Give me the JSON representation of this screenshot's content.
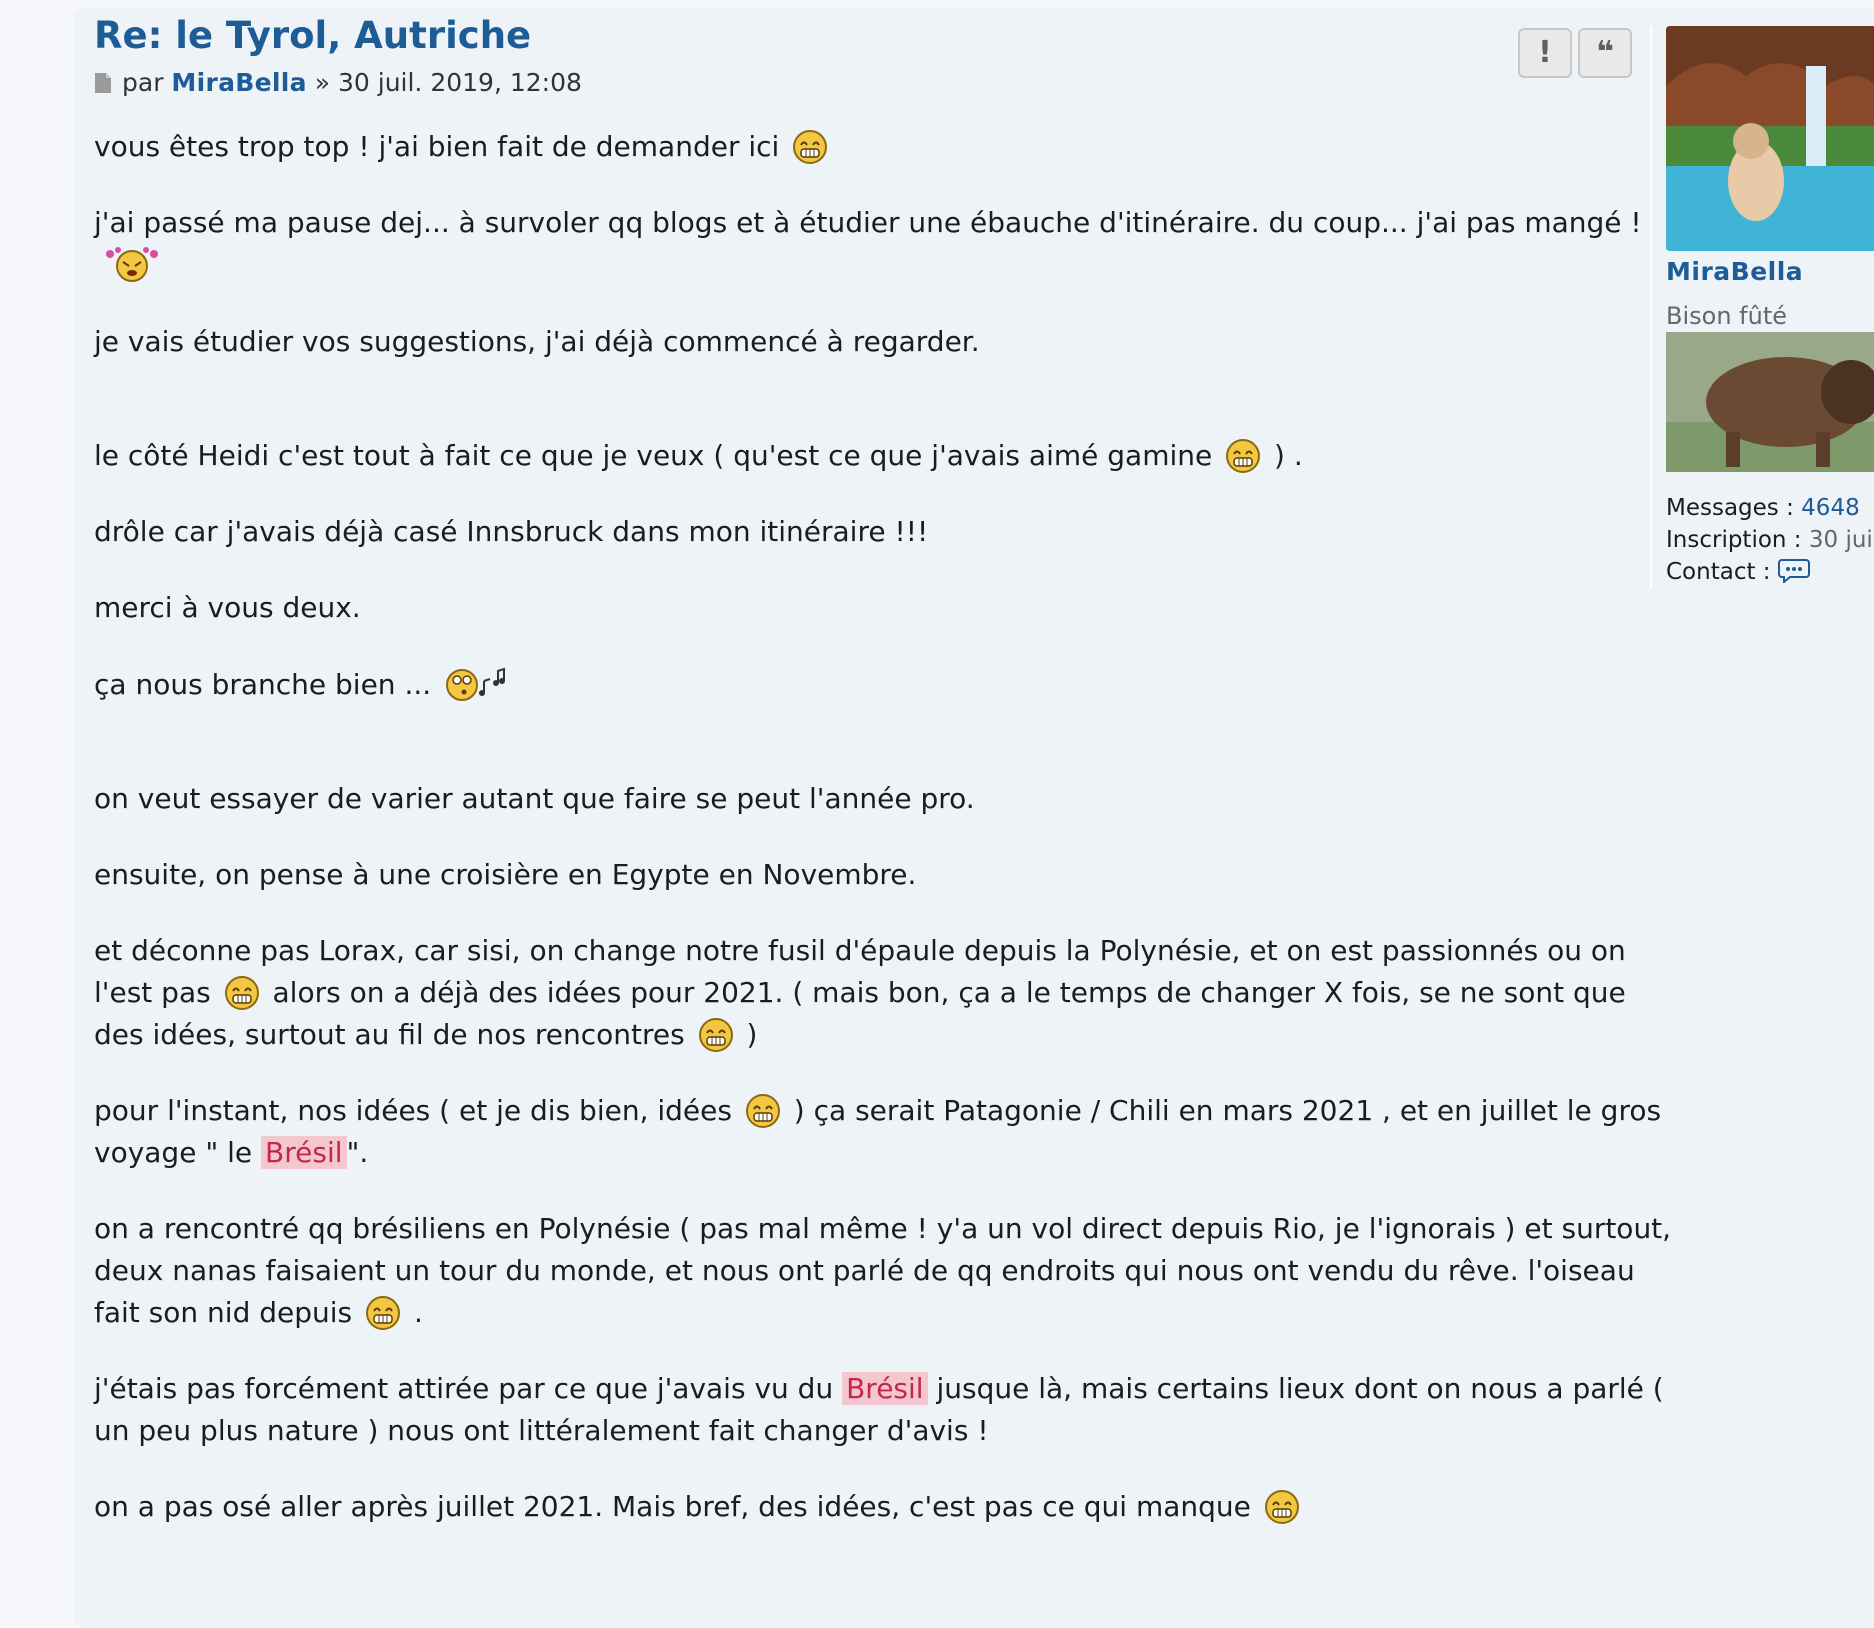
{
  "post": {
    "title": "Re: le Tyrol, Autriche",
    "by_label": "par",
    "author": "MiraBella",
    "date": "» 30 juil. 2019, 12:08",
    "buttons": {
      "report": "!",
      "quote": "❝"
    },
    "paragraphs": [
      {
        "text": "vous êtes trop top ! j'ai bien fait de demander ici",
        "smiley": "grin"
      },
      {
        "text": "j'ai passé ma pause dej... à survoler qq blogs et à étudier une ébauche d'itinéraire. du coup... j'ai pas mangé !",
        "smiley": "dizzy"
      },
      {
        "text": "je vais étudier vos suggestions, j'ai déjà commencé à regarder."
      },
      {
        "text_a": "le côté Heidi c'est tout à fait ce que je veux ( qu'est ce que j'avais aimé gamine",
        "text_b": ") ."
      },
      {
        "text": "drôle car j'avais déjà casé Innsbruck dans mon itinéraire !!!"
      },
      {
        "text": "merci à vous deux."
      },
      {
        "text": "ça nous branche bien ...",
        "smiley": "whistle"
      },
      {
        "text": "on veut essayer de varier autant que faire se peut l'année pro."
      },
      {
        "text": "ensuite, on pense à une croisière en Egypte en Novembre."
      },
      {
        "text_a": "et déconne pas Lorax, car sisi, on change notre fusil d'épaule depuis la Polynésie, et on est passionnés ou on l'est pas",
        "text_b": "alors on a déjà des idées pour 2021. ( mais bon, ça a le temps de changer X fois, se ne sont que des idées, surtout au fil de nos rencontres",
        "text_c": ")"
      },
      {
        "text_a": "pour l'instant, nos idées ( et je dis bien, idées",
        "text_b": ") ça serait Patagonie / Chili en mars 2021 , et en juillet le gros voyage \" le",
        "highlight": "Brésil",
        "text_c": "\"."
      },
      {
        "text_a": "on a rencontré qq brésiliens en Polynésie ( pas mal même ! y'a un vol direct depuis Rio, je l'ignorais ) et surtout, deux nanas faisaient un tour du monde, et nous ont parlé de qq endroits qui nous ont vendu du rêve. l'oiseau fait son nid depuis",
        "text_b": "."
      },
      {
        "text_a": "j'étais pas forcément attirée par ce que j'avais vu du",
        "highlight": "Brésil",
        "text_b": "jusque là, mais certains lieux dont on nous a parlé ( un peu plus nature ) nous ont littéralement fait changer d'avis !"
      },
      {
        "text": "on a pas osé aller après juillet 2021. Mais bref, des idées, c'est pas ce qui manque",
        "smiley": "grin"
      }
    ]
  },
  "profile": {
    "username": "MiraBella",
    "rank": "Bison fûté",
    "messages_label": "Messages :",
    "messages_value": "4648",
    "inscription_label": "Inscription :",
    "inscription_value": "30 jui",
    "contact_label": "Contact :"
  },
  "colors": {
    "link": "#1d5c97",
    "highlight_bg": "#f4c7cf",
    "highlight_text": "#c2284e",
    "post_bg": "#eef3f8"
  }
}
